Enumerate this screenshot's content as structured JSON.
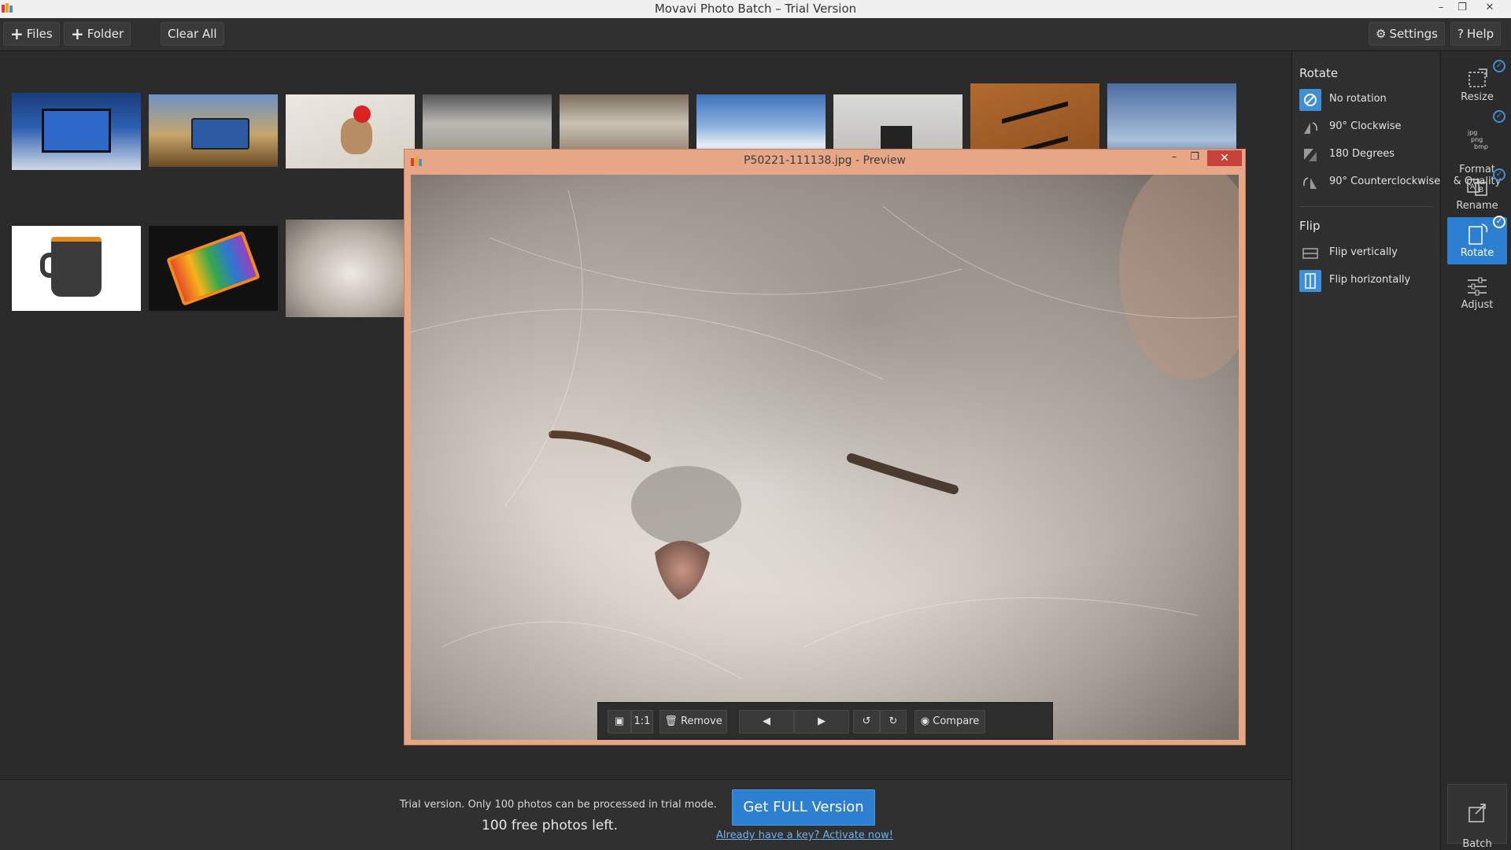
{
  "window": {
    "title": "Movavi Photo Batch – Trial Version",
    "controls": {
      "minimize": "–",
      "restore": "❐",
      "close": "✕"
    }
  },
  "toolbar": {
    "files_label": "Files",
    "folder_label": "Folder",
    "clear_all_label": "Clear All",
    "settings_label": "Settings",
    "help_label": "Help"
  },
  "gallery": {
    "thumbnails": [
      "tablet with webpage",
      "tablet on beach",
      "toy bear with red flower",
      "rocky landscape",
      "hotel lobby",
      "clouds from above",
      "office desk",
      "quadcopter drone",
      "blue sky with clouds",
      "orange crown mug",
      "colorful smartphone",
      "fluffy cat"
    ]
  },
  "options": {
    "rotate_heading": "Rotate",
    "rotate_items": [
      {
        "label": "No rotation",
        "icon": "no-rotation-icon",
        "selected": true
      },
      {
        "label": "90° Clockwise",
        "icon": "rotate-cw-icon",
        "selected": false
      },
      {
        "label": "180 Degrees",
        "icon": "rotate-180-icon",
        "selected": false
      },
      {
        "label": "90° Counterclockwise",
        "icon": "rotate-ccw-icon",
        "selected": false
      }
    ],
    "flip_heading": "Flip",
    "flip_items": [
      {
        "label": "Flip vertically",
        "icon": "flip-vertical-icon",
        "selected": false
      },
      {
        "label": "Flip horizontally",
        "icon": "flip-horizontal-icon",
        "selected": true
      }
    ]
  },
  "rail": {
    "tools": [
      {
        "label": "Resize",
        "icon": "resize-icon",
        "checked": true,
        "active": false
      },
      {
        "label": "Format\n& Quality",
        "icon": "format-icon",
        "checked": true,
        "active": false
      },
      {
        "label": "Rename",
        "icon": "rename-icon",
        "checked": true,
        "active": false
      },
      {
        "label": "Rotate",
        "icon": "rotate-icon",
        "checked": true,
        "active": true
      },
      {
        "label": "Adjust",
        "icon": "adjust-icon",
        "checked": false,
        "active": false
      }
    ],
    "batch_export_label": "Batch\nExport"
  },
  "bottom": {
    "trial_text": "Trial version. Only 100 photos can be processed in trial mode.",
    "free_left": "100 free photos left.",
    "get_full_label": "Get FULL Version",
    "activate_label": "Already have a key? Activate now!"
  },
  "preview": {
    "title": "P50221-111138.jpg - Preview",
    "one_to_one_label": "1:1",
    "remove_label": "Remove",
    "compare_label": "Compare"
  },
  "colors": {
    "accent": "#2d7fd1",
    "preview_frame": "#e7a787",
    "close_red": "#c7413a"
  }
}
